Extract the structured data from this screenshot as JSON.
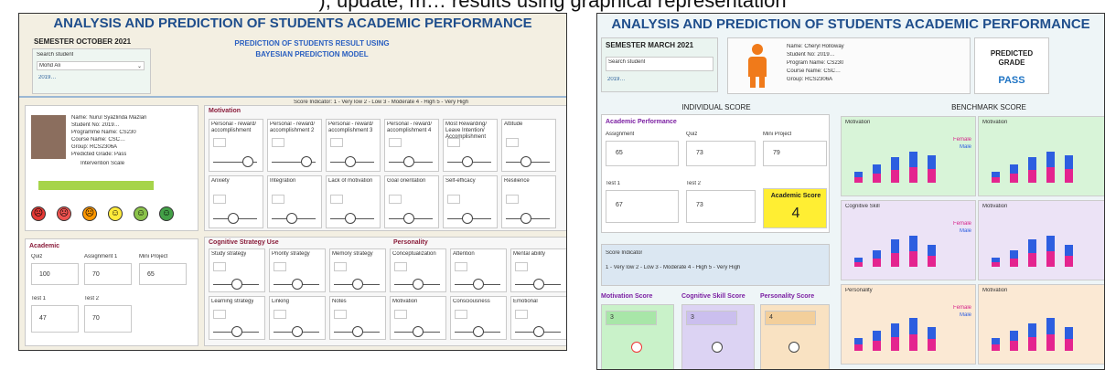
{
  "caption": "), update, m… results using graphical representation",
  "left": {
    "title": "ANALYSIS AND PREDICTION OF STUDENTS ACADEMIC PERFORMANCE",
    "semester": "SEMESTER OCTOBER 2021",
    "subtitle1": "PREDICTION OF STUDENTS RESULT USING",
    "subtitle2": "BAYESIAN PREDICTION MODEL",
    "search_label": "Search student",
    "search_value": "Mohd Ali",
    "list_item": "2019…",
    "score_indicator": "Score Indicator: 1 - Very low   2 - Low   3 - Moderate   4 - High   5 - Very High",
    "profile": {
      "name": "Name: Nurul Syazlinda Mazlan",
      "student_no": "Student No: 2019…",
      "programme": "Programme Name: CS230",
      "course": "Course Name: CSC…",
      "group": "Group: RCS2306A",
      "predicted": "Predicted Grade: Pass",
      "intervention": "Intervention Scale"
    },
    "motivation_title": "Motivation",
    "motivation": [
      "Personal - reward/ accomplishment",
      "Personal - reward/ accomplishment 2",
      "Personal - reward/ accomplishment 3",
      "Personal - reward/ accomplishment 4",
      "Most Rewarding/ Leave Intention/ Accomplishment",
      "Attitude"
    ],
    "motivation_row2": [
      "Anxiety",
      "Integration",
      "Lack of motivation",
      "Goal orientation",
      "Self-efficacy",
      "Resilience"
    ],
    "cog_title": "Cognitive Strategy Use",
    "cog": [
      "Study strategy",
      "Priority strategy",
      "Memory strategy",
      "Learning strategy",
      "Linking",
      "Notes"
    ],
    "pers_title": "Personality",
    "pers": [
      "Conceptualization",
      "Attention",
      "Mental ability",
      "Motivation",
      "Consciousness",
      "Emotional"
    ],
    "acad_title": "Academic",
    "acad_labels": [
      "Quiz",
      "Assignment 1",
      "Mini Project",
      "Test 1",
      "Test 2"
    ],
    "acad_values": [
      "100",
      "70",
      "65",
      "47",
      "70"
    ]
  },
  "right": {
    "title": "ANALYSIS AND PREDICTION OF STUDENTS ACADEMIC PERFORMANCE",
    "semester": "SEMESTER MARCH 2021",
    "search_label": "Search student",
    "list_item": "2019…",
    "profile": {
      "name": "Name: Cheryl Holloway",
      "student_no": "Student No: 2019…",
      "programme": "Program Name: CS230",
      "course": "Course Name: CSC…",
      "group": "Group: RCS2306A"
    },
    "predicted_label1": "PREDICTED",
    "predicted_label2": "GRADE",
    "predicted_value": "PASS",
    "individual": "INDIVIDUAL SCORE",
    "benchmark": "BENCHMARK SCORE",
    "acad_perf": "Academic Performance",
    "fields": [
      "Assignment",
      "Quiz",
      "Mini Project",
      "Test 1",
      "Test 2"
    ],
    "values": [
      "65",
      "73",
      "79",
      "67",
      "73"
    ],
    "acad_score_label": "Academic Score",
    "acad_score": "4",
    "score_indicator": "Score Indicator",
    "score_levels": "1 - Very low   2 - Low   3 - Moderate   4 - High   5 - Very High",
    "mot_score": "Motivation Score",
    "cog_score": "Cognitive Skill Score",
    "pers_score": "Personality Score",
    "score_vals": [
      "3",
      "3",
      "4"
    ],
    "charts": [
      "Motivation",
      "Cognitive Skill",
      "Personality"
    ],
    "charts2": [
      "Motivation",
      "Motivation",
      "Motivation"
    ],
    "legend": [
      "Female",
      "Male"
    ]
  }
}
